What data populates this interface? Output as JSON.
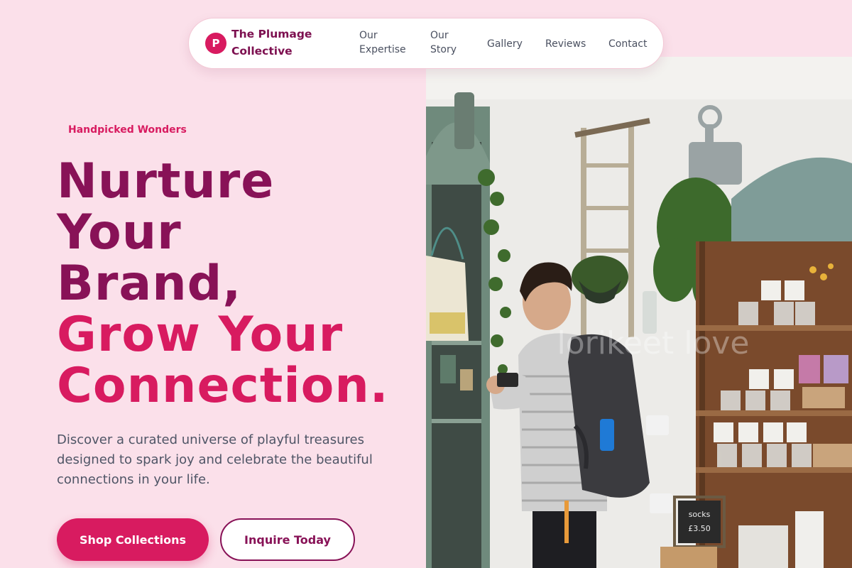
{
  "brand": {
    "initial": "P",
    "name_line1": "The Plumage",
    "name_line2": "Collective"
  },
  "nav": {
    "expertise_line1": "Our",
    "expertise_line2": "Expertise",
    "story_line1": "Our",
    "story_line2": "Story",
    "gallery": "Gallery",
    "reviews": "Reviews",
    "contact": "Contact"
  },
  "hero": {
    "eyebrow": "Handpicked Wonders",
    "headline": {
      "line1": "Nurture",
      "line2": "Your",
      "line3": "Brand,",
      "line4": "Grow Your",
      "line5": "Connection."
    },
    "lede": "Discover a curated universe of playful treasures designed to spark joy and celebrate the beautiful connections in your life.",
    "primary_cta": "Shop Collections",
    "secondary_cta": "Inquire Today"
  },
  "image": {
    "watermark": "lorikeet love",
    "sign_line1": "socks",
    "sign_line2": "£3.50"
  },
  "colors": {
    "page_bg": "#fbe0ea",
    "brand_dark": "#881257",
    "brand_bright": "#d81b60",
    "body_text": "#4f5566"
  }
}
